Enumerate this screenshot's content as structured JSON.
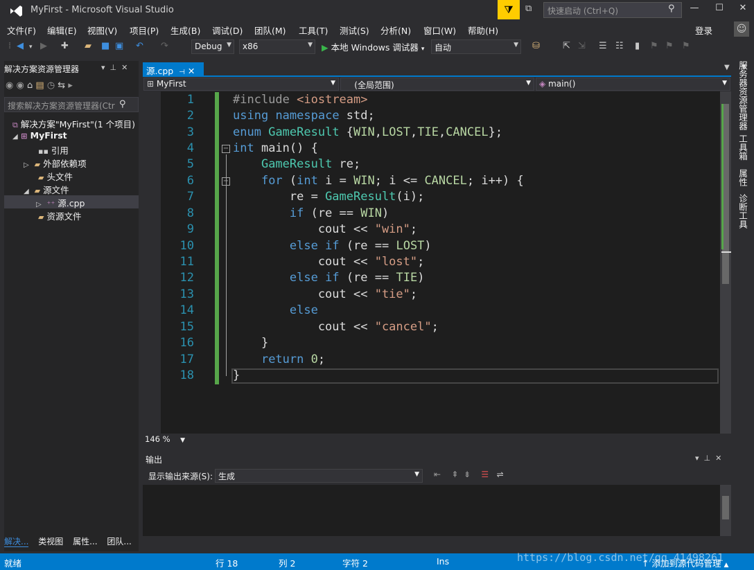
{
  "window": {
    "title": "MyFirst - Microsoft Visual Studio",
    "quick_launch_placeholder": "快速启动 (Ctrl+Q)",
    "login": "登录"
  },
  "menu": [
    "文件(F)",
    "编辑(E)",
    "视图(V)",
    "项目(P)",
    "生成(B)",
    "调试(D)",
    "团队(M)",
    "工具(T)",
    "测试(S)",
    "分析(N)",
    "窗口(W)",
    "帮助(H)"
  ],
  "toolbar": {
    "config": "Debug",
    "platform": "x86",
    "run_label": "本地 Windows 调试器",
    "run_mode": "自动"
  },
  "solution_explorer": {
    "title": "解决方案资源管理器",
    "search_placeholder": "搜索解决方案资源管理器(Ctr",
    "items": [
      {
        "label": "解决方案\"MyFirst\"(1 个项目)"
      },
      {
        "label": "MyFirst"
      },
      {
        "label": "引用"
      },
      {
        "label": "外部依赖项"
      },
      {
        "label": "头文件"
      },
      {
        "label": "源文件"
      },
      {
        "label": "源.cpp"
      },
      {
        "label": "资源文件"
      }
    ],
    "tabs": [
      "解决...",
      "类视图",
      "属性...",
      "团队..."
    ]
  },
  "editor": {
    "tab": "源.cpp",
    "nav_project": "MyFirst",
    "nav_scope": "(全局范围)",
    "nav_member": "main()",
    "zoom": "146 %",
    "line_numbers": [
      "1",
      "2",
      "3",
      "4",
      "5",
      "6",
      "7",
      "8",
      "9",
      "10",
      "11",
      "12",
      "13",
      "14",
      "15",
      "16",
      "17",
      "18"
    ]
  },
  "output": {
    "title": "输出",
    "source_label": "显示输出来源(S):",
    "source_value": "生成"
  },
  "right_tabs": [
    "服务器资源管理器",
    "工具箱",
    "属性",
    "诊断工具"
  ],
  "status": {
    "ready": "就绪",
    "line": "行 18",
    "col": "列 2",
    "char": "字符 2",
    "ins": "Ins",
    "source_control": "添加到源代码管理"
  },
  "watermark": "https://blog.csdn.net/qq_41498261"
}
